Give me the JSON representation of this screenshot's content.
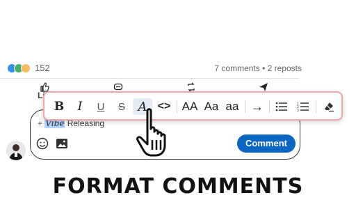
{
  "post_stats": {
    "reaction_count": "152",
    "comments_reposts": "7 comments • 2 reposts",
    "reaction_icons": [
      "like-icon",
      "celebrate-icon",
      "support-icon"
    ]
  },
  "actions": {
    "like_label": "Li",
    "icons": [
      "thumbs-up-icon",
      "comment-icon",
      "repost-icon",
      "send-icon"
    ]
  },
  "toolbar": {
    "buttons": [
      {
        "name": "bold",
        "label": "B"
      },
      {
        "name": "italic",
        "label": "I"
      },
      {
        "name": "underline",
        "label": "U"
      },
      {
        "name": "strikethrough",
        "label": "S"
      },
      {
        "name": "script",
        "label": "A"
      },
      {
        "name": "code",
        "label": "<>"
      },
      {
        "name": "uppercase",
        "label": "AA"
      },
      {
        "name": "titlecase",
        "label": "Aa"
      },
      {
        "name": "lowercase",
        "label": "aa"
      },
      {
        "name": "arrow",
        "label": "→"
      },
      {
        "name": "bulleted-list",
        "label": ""
      },
      {
        "name": "numbered-list",
        "label": ""
      },
      {
        "name": "eraser",
        "label": ""
      }
    ],
    "active": "script"
  },
  "comment": {
    "prefix": "+ ",
    "selected_text": "Vibe",
    "rest_text": " Releasing",
    "button_label": "Comment"
  },
  "headline": "FORMAT COMMENTS",
  "colors": {
    "accent": "#0a66c2",
    "toolbar_border": "#f2a6ac",
    "selection": "#b4d5fe"
  }
}
